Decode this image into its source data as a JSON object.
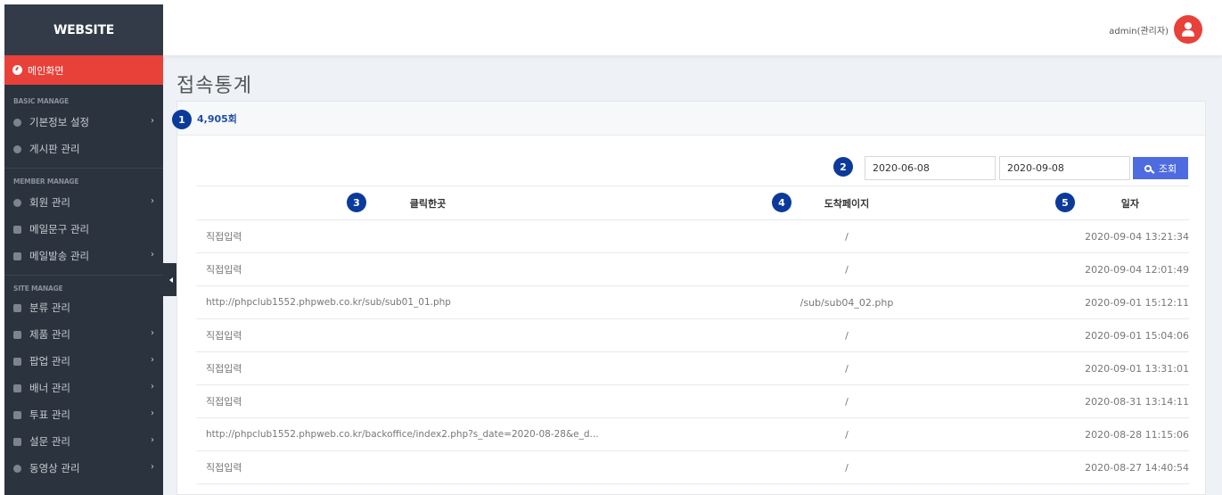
{
  "brand": "WEBSITE",
  "sidebar": {
    "active_item": "메인화면",
    "sections": [
      {
        "title": "BASIC MANAGE",
        "items": [
          {
            "label": "기본정보 설정",
            "chevron": true
          },
          {
            "label": "게시판 관리",
            "chevron": false
          }
        ]
      },
      {
        "title": "MEMBER MANAGE",
        "items": [
          {
            "label": "회원 관리",
            "chevron": true
          },
          {
            "label": "메일문구 관리",
            "chevron": false
          },
          {
            "label": "메일발송 관리",
            "chevron": true
          }
        ]
      },
      {
        "title": "SITE MANAGE",
        "items": [
          {
            "label": "분류 관리",
            "chevron": false
          },
          {
            "label": "제품 관리",
            "chevron": true
          },
          {
            "label": "팝업 관리",
            "chevron": true
          },
          {
            "label": "배너 관리",
            "chevron": true
          },
          {
            "label": "투표 관리",
            "chevron": true
          },
          {
            "label": "설문 관리",
            "chevron": true
          },
          {
            "label": "동영상 관리",
            "chevron": true
          }
        ]
      }
    ]
  },
  "header": {
    "user": "admin(관리자)"
  },
  "page": {
    "title": "접속통계",
    "count": "4,905회",
    "badges": [
      "1",
      "2",
      "3",
      "4",
      "5"
    ],
    "filter": {
      "start_date": "2020-06-08",
      "end_date": "2020-09-08",
      "search_label": "조회"
    }
  },
  "table": {
    "headers": [
      "클릭한곳",
      "도착페이지",
      "일자"
    ],
    "rows": [
      {
        "from": "직접입력",
        "to": "/",
        "date": "2020-09-04 13:21:34"
      },
      {
        "from": "직접입력",
        "to": "/",
        "date": "2020-09-04 12:01:49"
      },
      {
        "from": "http://phpclub1552.phpweb.co.kr/sub/sub01_01.php",
        "to": "/sub/sub04_02.php",
        "date": "2020-09-01 15:12:11"
      },
      {
        "from": "직접입력",
        "to": "/",
        "date": "2020-09-01 15:04:06"
      },
      {
        "from": "직접입력",
        "to": "/",
        "date": "2020-09-01 13:31:01"
      },
      {
        "from": "직접입력",
        "to": "/",
        "date": "2020-08-31 13:14:11"
      },
      {
        "from": "http://phpclub1552.phpweb.co.kr/backoffice/index2.php?s_date=2020-08-28&e_d...",
        "to": "/",
        "date": "2020-08-28 11:15:06"
      },
      {
        "from": "직접입력",
        "to": "/",
        "date": "2020-08-27 14:40:54"
      }
    ]
  },
  "colors": {
    "accent": "#e8413a",
    "sidebar": "#2b333e",
    "badge": "#0b3a9b",
    "button": "#4e6ce0"
  }
}
